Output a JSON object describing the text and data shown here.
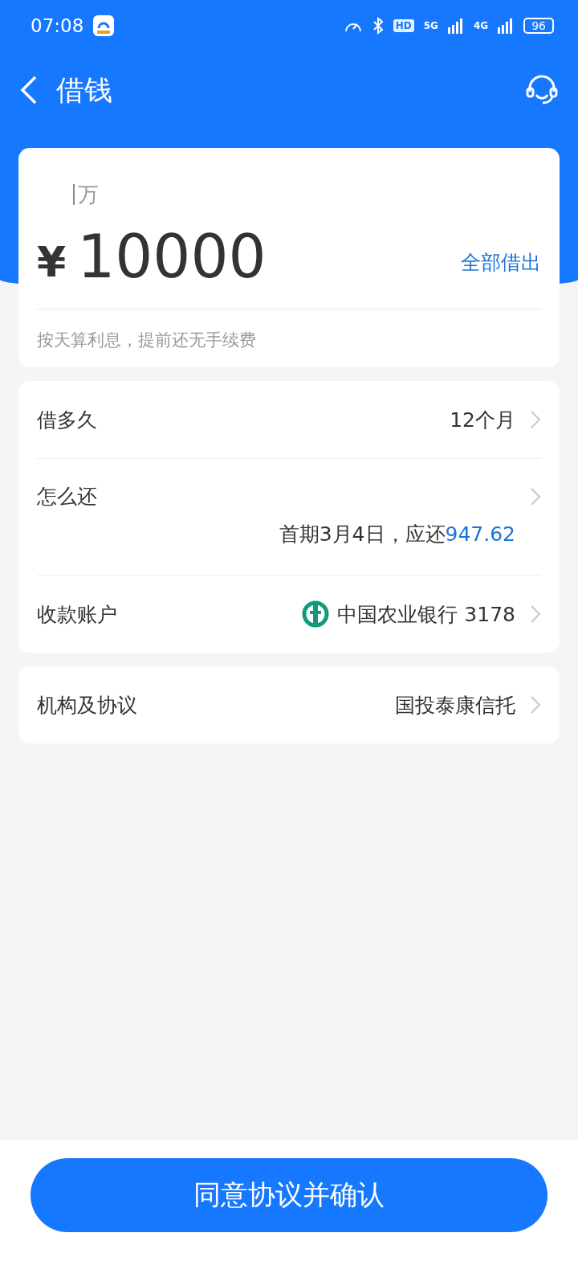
{
  "status_bar": {
    "time": "07:08",
    "network_5g": "5G",
    "network_4g": "4G",
    "hd": "HD",
    "battery": "96"
  },
  "header": {
    "title": "借钱"
  },
  "amount_card": {
    "unit_hint": "万",
    "currency": "¥",
    "amount": "10000",
    "max_button": "全部借出",
    "note": "按天算利息，提前还无手续费"
  },
  "details": [
    {
      "kind": "value",
      "label": "借多久",
      "value": "12个月"
    },
    {
      "kind": "schedule",
      "label": "怎么还",
      "value": "首期3月4日，应还",
      "amount": "947.62"
    },
    {
      "kind": "bank",
      "label": "收款账户",
      "value": "中国农业银行 3178"
    }
  ],
  "institution": {
    "label": "机构及协议",
    "value": "国投泰康信托"
  },
  "confirm_button": "同意协议并确认"
}
